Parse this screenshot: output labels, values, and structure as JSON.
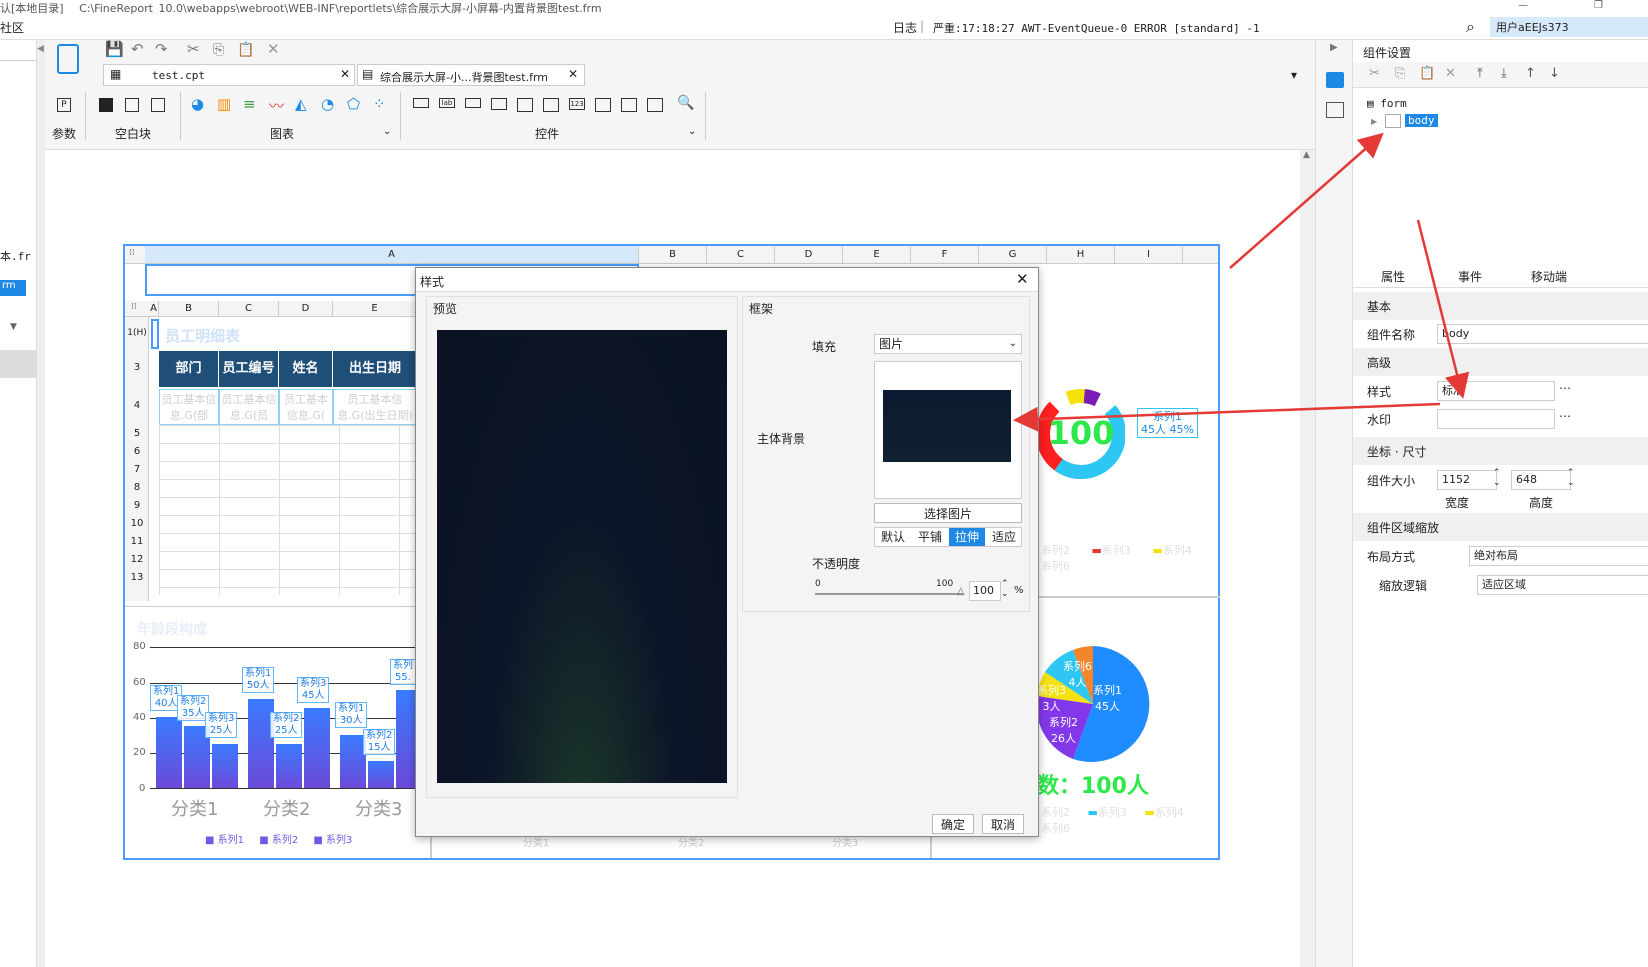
{
  "window": {
    "title_prefix": "认[本地目录]",
    "path": "C:\\FineReport_10.0\\webapps\\webroot\\WEB-INF\\reportlets\\综合展示大屏-小屏幕-内置背景图test.frm"
  },
  "menubar": {
    "left_text": "社区",
    "log_label": "日志",
    "log_message": "严重:17:18:27 AWT-EventQueue-0 ERROR [standard] -1",
    "user_label": "用户aEEJs373"
  },
  "leftpanel": {
    "item1": "本.fr",
    "item2": "rm"
  },
  "tabs": [
    {
      "label": "test.cpt"
    },
    {
      "label": "综合展示大屏-小...背景图test.frm"
    }
  ],
  "toolbar": {
    "groups": [
      "参数",
      "空白块",
      "图表",
      "控件"
    ]
  },
  "sheet": {
    "columns_top": [
      "A",
      "B",
      "C",
      "D",
      "E",
      "F",
      "G",
      "H",
      "I"
    ],
    "columns_inner": [
      "A",
      "B",
      "C",
      "D",
      "E"
    ],
    "row_numbers": [
      "1(H)",
      "3",
      "4",
      "5",
      "6",
      "7",
      "8",
      "9",
      "10",
      "11",
      "12",
      "13"
    ],
    "table_title": "员工明细表",
    "headers": [
      "部门",
      "员工编号",
      "姓名",
      "出生日期"
    ],
    "row4": [
      "员工基本信息.G(部",
      "员工基本信息.G(员",
      "员工基本信息.G(",
      "员工基本信息.G(出生日期)"
    ]
  },
  "bar_chart": {
    "title": "年龄段构成",
    "y_ticks": [
      "0",
      "20",
      "40",
      "60",
      "80"
    ],
    "categories": [
      "分类1",
      "分类2",
      "分类3"
    ],
    "labels": [
      {
        "name": "系列1",
        "value": "40人"
      },
      {
        "name": "系列2",
        "value": "35人"
      },
      {
        "name": "系列3",
        "value": "25人"
      },
      {
        "name": "系列1",
        "value": "50人"
      },
      {
        "name": "系列2",
        "value": "25人"
      },
      {
        "name": "系列3",
        "value": "45人"
      },
      {
        "name": "系列1",
        "value": "30人"
      },
      {
        "name": "系列2",
        "value": "15人"
      },
      {
        "name": "系列",
        "value": "55."
      }
    ],
    "legend": [
      "系列1",
      "系列2",
      "系列3"
    ]
  },
  "chart_data": {
    "type": "bar",
    "title": "年龄段构成",
    "categories": [
      "分类1",
      "分类2",
      "分类3"
    ],
    "ylim": [
      0,
      80
    ],
    "series": [
      {
        "name": "系列1",
        "values": [
          40,
          50,
          30
        ]
      },
      {
        "name": "系列2",
        "values": [
          35,
          25,
          15
        ]
      },
      {
        "name": "系列3",
        "values": [
          25,
          45,
          55
        ]
      }
    ]
  },
  "right_charts": {
    "gauge_value": "100",
    "gauge_label": "系列1",
    "gauge_sub": "45人 45%",
    "legend_top": [
      "系列2",
      "系列3",
      "系列4",
      "系列6"
    ],
    "pie_labels": [
      {
        "name": "系列1",
        "value": "45人"
      },
      {
        "name": "系列2",
        "value": "26人"
      },
      {
        "name": "系列3",
        "value": "3人"
      },
      {
        "name": "系列6",
        "value": "4人"
      }
    ],
    "total_text": "数：100人",
    "legend_bottom": [
      "系列2",
      "系列3",
      "系列4",
      "系列6"
    ],
    "bottom_cats": [
      "分类1",
      "分类2",
      "分类3"
    ]
  },
  "dialog": {
    "title": "样式",
    "preview_label": "预览",
    "frame_label": "框架",
    "fill_label": "填充",
    "fill_value": "图片",
    "bg_label": "主体背景",
    "choose_image": "选择图片",
    "modes": [
      "默认",
      "平铺",
      "拉伸",
      "适应"
    ],
    "opacity_label": "不透明度",
    "slider_min": "0",
    "slider_max": "100",
    "opacity_value": "100",
    "percent": "%",
    "ok": "确定",
    "cancel": "取消"
  },
  "rightpanel": {
    "title": "组件设置",
    "tree_form": "form",
    "tree_body": "body",
    "tabs": [
      "属性",
      "事件",
      "移动端"
    ],
    "section_basic": "基本",
    "name_label": "组件名称",
    "name_value": "body",
    "section_advanced": "高级",
    "style_label": "样式",
    "style_value": "标准",
    "watermark_label": "水印",
    "section_coord": "坐标 · 尺寸",
    "size_label": "组件大小",
    "width_value": "1152",
    "height_value": "648",
    "width_caption": "宽度",
    "height_caption": "高度",
    "section_scale": "组件区域缩放",
    "layout_label": "布局方式",
    "layout_value": "绝对布局",
    "scale_label": "缩放逻辑",
    "scale_value": "适应区域"
  },
  "colors": {
    "accent": "#1e88e5",
    "header_bg": "#1f4e79",
    "dialog_preview": "#0d1628",
    "arrow": "#e53935"
  }
}
